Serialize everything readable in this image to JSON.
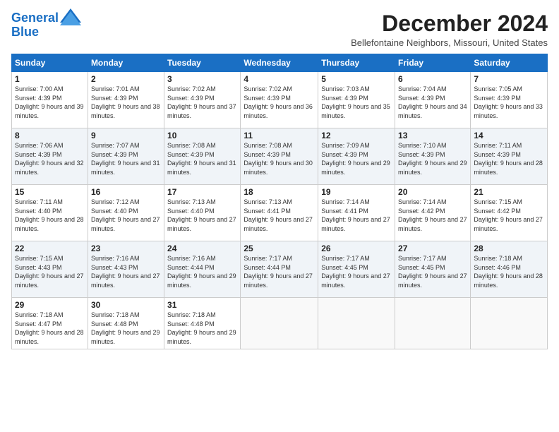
{
  "header": {
    "logo_line1": "General",
    "logo_line2": "Blue",
    "month_title": "December 2024",
    "location": "Bellefontaine Neighbors, Missouri, United States"
  },
  "weekdays": [
    "Sunday",
    "Monday",
    "Tuesday",
    "Wednesday",
    "Thursday",
    "Friday",
    "Saturday"
  ],
  "weeks": [
    [
      {
        "day": "1",
        "sunrise": "7:00 AM",
        "sunset": "4:39 PM",
        "daylight": "9 hours and 39 minutes."
      },
      {
        "day": "2",
        "sunrise": "7:01 AM",
        "sunset": "4:39 PM",
        "daylight": "9 hours and 38 minutes."
      },
      {
        "day": "3",
        "sunrise": "7:02 AM",
        "sunset": "4:39 PM",
        "daylight": "9 hours and 37 minutes."
      },
      {
        "day": "4",
        "sunrise": "7:02 AM",
        "sunset": "4:39 PM",
        "daylight": "9 hours and 36 minutes."
      },
      {
        "day": "5",
        "sunrise": "7:03 AM",
        "sunset": "4:39 PM",
        "daylight": "9 hours and 35 minutes."
      },
      {
        "day": "6",
        "sunrise": "7:04 AM",
        "sunset": "4:39 PM",
        "daylight": "9 hours and 34 minutes."
      },
      {
        "day": "7",
        "sunrise": "7:05 AM",
        "sunset": "4:39 PM",
        "daylight": "9 hours and 33 minutes."
      }
    ],
    [
      {
        "day": "8",
        "sunrise": "7:06 AM",
        "sunset": "4:39 PM",
        "daylight": "9 hours and 32 minutes."
      },
      {
        "day": "9",
        "sunrise": "7:07 AM",
        "sunset": "4:39 PM",
        "daylight": "9 hours and 31 minutes."
      },
      {
        "day": "10",
        "sunrise": "7:08 AM",
        "sunset": "4:39 PM",
        "daylight": "9 hours and 31 minutes."
      },
      {
        "day": "11",
        "sunrise": "7:08 AM",
        "sunset": "4:39 PM",
        "daylight": "9 hours and 30 minutes."
      },
      {
        "day": "12",
        "sunrise": "7:09 AM",
        "sunset": "4:39 PM",
        "daylight": "9 hours and 29 minutes."
      },
      {
        "day": "13",
        "sunrise": "7:10 AM",
        "sunset": "4:39 PM",
        "daylight": "9 hours and 29 minutes."
      },
      {
        "day": "14",
        "sunrise": "7:11 AM",
        "sunset": "4:39 PM",
        "daylight": "9 hours and 28 minutes."
      }
    ],
    [
      {
        "day": "15",
        "sunrise": "7:11 AM",
        "sunset": "4:40 PM",
        "daylight": "9 hours and 28 minutes."
      },
      {
        "day": "16",
        "sunrise": "7:12 AM",
        "sunset": "4:40 PM",
        "daylight": "9 hours and 27 minutes."
      },
      {
        "day": "17",
        "sunrise": "7:13 AM",
        "sunset": "4:40 PM",
        "daylight": "9 hours and 27 minutes."
      },
      {
        "day": "18",
        "sunrise": "7:13 AM",
        "sunset": "4:41 PM",
        "daylight": "9 hours and 27 minutes."
      },
      {
        "day": "19",
        "sunrise": "7:14 AM",
        "sunset": "4:41 PM",
        "daylight": "9 hours and 27 minutes."
      },
      {
        "day": "20",
        "sunrise": "7:14 AM",
        "sunset": "4:42 PM",
        "daylight": "9 hours and 27 minutes."
      },
      {
        "day": "21",
        "sunrise": "7:15 AM",
        "sunset": "4:42 PM",
        "daylight": "9 hours and 27 minutes."
      }
    ],
    [
      {
        "day": "22",
        "sunrise": "7:15 AM",
        "sunset": "4:43 PM",
        "daylight": "9 hours and 27 minutes."
      },
      {
        "day": "23",
        "sunrise": "7:16 AM",
        "sunset": "4:43 PM",
        "daylight": "9 hours and 27 minutes."
      },
      {
        "day": "24",
        "sunrise": "7:16 AM",
        "sunset": "4:44 PM",
        "daylight": "9 hours and 29 minutes."
      },
      {
        "day": "25",
        "sunrise": "7:17 AM",
        "sunset": "4:44 PM",
        "daylight": "9 hours and 27 minutes."
      },
      {
        "day": "26",
        "sunrise": "7:17 AM",
        "sunset": "4:45 PM",
        "daylight": "9 hours and 27 minutes."
      },
      {
        "day": "27",
        "sunrise": "7:17 AM",
        "sunset": "4:45 PM",
        "daylight": "9 hours and 27 minutes."
      },
      {
        "day": "28",
        "sunrise": "7:18 AM",
        "sunset": "4:46 PM",
        "daylight": "9 hours and 28 minutes."
      }
    ],
    [
      {
        "day": "29",
        "sunrise": "7:18 AM",
        "sunset": "4:47 PM",
        "daylight": "9 hours and 28 minutes."
      },
      {
        "day": "30",
        "sunrise": "7:18 AM",
        "sunset": "4:48 PM",
        "daylight": "9 hours and 29 minutes."
      },
      {
        "day": "31",
        "sunrise": "7:18 AM",
        "sunset": "4:48 PM",
        "daylight": "9 hours and 29 minutes."
      },
      null,
      null,
      null,
      null
    ]
  ]
}
